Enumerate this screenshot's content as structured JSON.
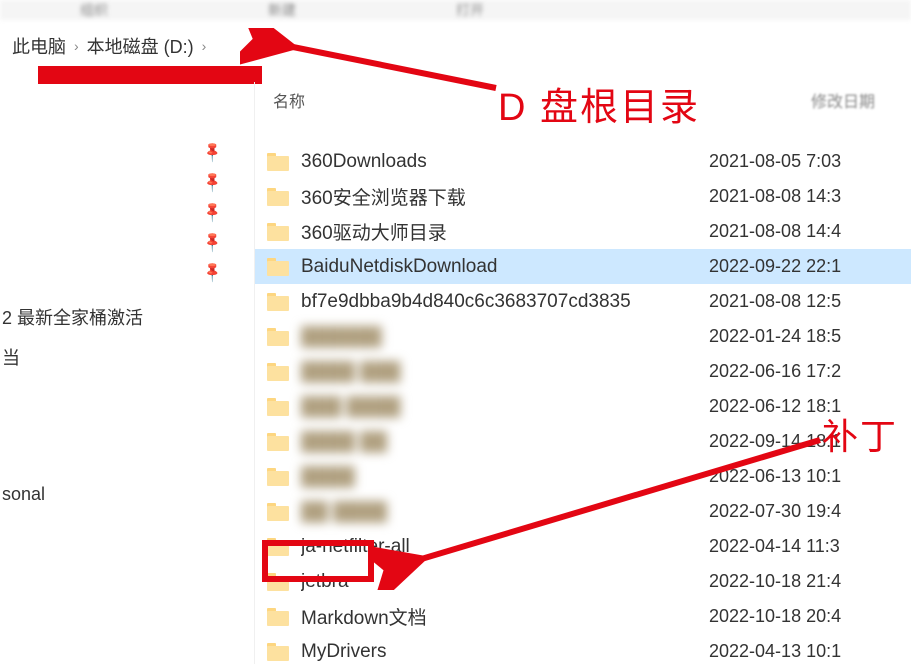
{
  "toolbar_blur": [
    "组织",
    "新建",
    "打开"
  ],
  "breadcrumb": {
    "items": [
      "此电脑",
      "本地磁盘 (D:)"
    ]
  },
  "sidebar": {
    "items": [
      {
        "label": "2 最新全家桶激活"
      },
      {
        "label": "当"
      },
      {
        "label": "sonal"
      }
    ]
  },
  "columns": {
    "name": "名称",
    "date": "修改日期"
  },
  "annotations": {
    "root_dir": "D 盘根目录",
    "patch": "补丁"
  },
  "files": [
    {
      "name": "360Downloads",
      "date": "2021-08-05 7:03",
      "blurred": false,
      "selected": false
    },
    {
      "name": "360安全浏览器下载",
      "date": "2021-08-08 14:3",
      "blurred": false,
      "selected": false
    },
    {
      "name": "360驱动大师目录",
      "date": "2021-08-08 14:4",
      "blurred": false,
      "selected": false
    },
    {
      "name": "BaiduNetdiskDownload",
      "date": "2022-09-22 22:1",
      "blurred": false,
      "selected": true
    },
    {
      "name": "bf7e9dbba9b4d840c6c3683707cd3835",
      "date": "2021-08-08 12:5",
      "blurred": false,
      "selected": false
    },
    {
      "name": "██████",
      "date": "2022-01-24 18:5",
      "blurred": true,
      "selected": false
    },
    {
      "name": "████ ███",
      "date": "2022-06-16 17:2",
      "blurred": true,
      "selected": false
    },
    {
      "name": "███ ████",
      "date": "2022-06-12 18:1",
      "blurred": true,
      "selected": false
    },
    {
      "name": "████ ██",
      "date": "2022-09-14 18:1",
      "blurred": true,
      "selected": false
    },
    {
      "name": "████",
      "date": "2022-06-13 10:1",
      "blurred": true,
      "selected": false
    },
    {
      "name": "██ ████",
      "date": "2022-07-30 19:4",
      "blurred": true,
      "selected": false
    },
    {
      "name": "ja-netfilter-all",
      "date": "2022-04-14 11:3",
      "blurred": false,
      "selected": false
    },
    {
      "name": "jetbra",
      "date": "2022-10-18 21:4",
      "blurred": false,
      "selected": false
    },
    {
      "name": "Markdown文档",
      "date": "2022-10-18 20:4",
      "blurred": false,
      "selected": false
    },
    {
      "name": "MyDrivers",
      "date": "2022-04-13 10:1",
      "blurred": false,
      "selected": false
    }
  ]
}
